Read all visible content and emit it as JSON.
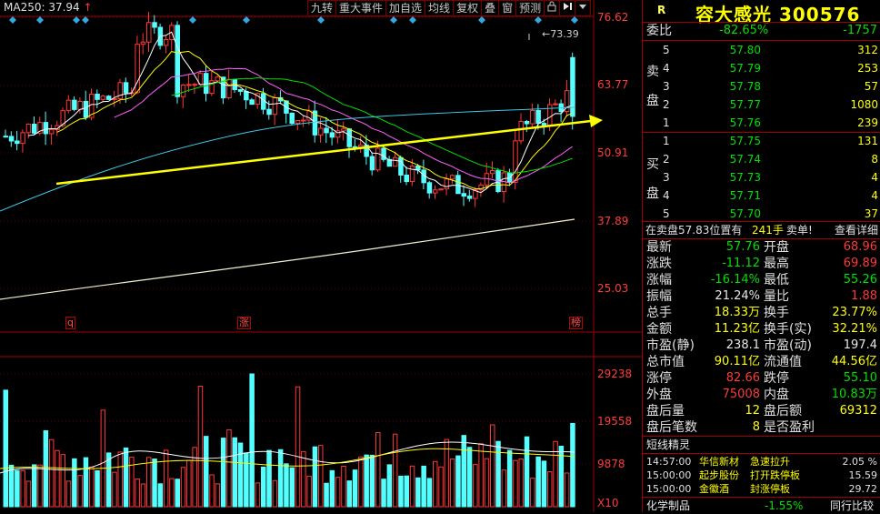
{
  "toolbar": {
    "items": [
      "九转",
      "重大事件",
      "加自选",
      "均线",
      "复权",
      "叠",
      "窗",
      "预测"
    ],
    "icons": [
      "lock-icon",
      "arrow-right-stop-icon",
      "dropdown-icon"
    ]
  },
  "ma_label": {
    "text": "MA250: 37.94",
    "arrow": "↑"
  },
  "price_axis": [
    "76.62",
    "63.77",
    "50.91",
    "37.89",
    "25.03"
  ],
  "volume_axis": [
    "29238",
    "19558",
    "9878",
    "X10"
  ],
  "annotation": "73.39",
  "markers": {
    "left": "q",
    "mid": "涨",
    "right": "榜"
  },
  "colors": {
    "up": "#ff3838",
    "down": "#54ffff",
    "border": "#a00000",
    "trend": "#ffff00"
  },
  "header": {
    "flag": "R",
    "name": "容大感光",
    "code": "300576"
  },
  "weibi": {
    "label": "委比",
    "ratio": "-82.65%",
    "diff": "-1757"
  },
  "sell_label": [
    "卖",
    "盘"
  ],
  "buy_label": [
    "买",
    "盘"
  ],
  "asks": [
    {
      "level": "5",
      "price": "57.80",
      "vol": "312"
    },
    {
      "level": "4",
      "price": "57.79",
      "vol": "253"
    },
    {
      "level": "3",
      "price": "57.78",
      "vol": "57"
    },
    {
      "level": "2",
      "price": "57.77",
      "vol": "1080"
    },
    {
      "level": "1",
      "price": "57.76",
      "vol": "239"
    }
  ],
  "bids": [
    {
      "level": "1",
      "price": "57.75",
      "vol": "131"
    },
    {
      "level": "2",
      "price": "57.74",
      "vol": "8"
    },
    {
      "level": "3",
      "price": "57.73",
      "vol": "4"
    },
    {
      "level": "4",
      "price": "57.71",
      "vol": "4"
    },
    {
      "level": "5",
      "price": "57.70",
      "vol": "37"
    }
  ],
  "big_order": {
    "text": "在卖盘57.83位置有",
    "qty": "241手",
    "type": "卖单!",
    "link": "查看详细"
  },
  "stats": [
    {
      "l1": "最新",
      "v1": "57.76",
      "c1": "green",
      "l2": "开盘",
      "v2": "68.96",
      "c2": "red"
    },
    {
      "l1": "涨跌",
      "v1": "-11.12",
      "c1": "green",
      "l2": "最高",
      "v2": "69.89",
      "c2": "red"
    },
    {
      "l1": "涨幅",
      "v1": "-16.14%",
      "c1": "green",
      "l2": "最低",
      "v2": "55.26",
      "c2": "green"
    },
    {
      "l1": "振幅",
      "v1": "21.24%",
      "c1": "white",
      "l2": "量比",
      "v2": "1.88",
      "c2": "red"
    },
    {
      "l1": "总手",
      "v1": "18.33万",
      "c1": "yellow",
      "l2": "换手",
      "v2": "23.77%",
      "c2": "yellow"
    },
    {
      "l1": "金额",
      "v1": "11.23亿",
      "c1": "yellow",
      "l2": "换手(实)",
      "v2": "32.21%",
      "c2": "yellow"
    },
    {
      "l1": "市盈(静)",
      "v1": "238.1",
      "c1": "white",
      "l2": "市盈(动)",
      "v2": "197.4",
      "c2": "white"
    },
    {
      "l1": "总市值",
      "v1": "90.11亿",
      "c1": "yellow",
      "l2": "流通值",
      "v2": "44.56亿",
      "c2": "yellow"
    },
    {
      "l1": "涨停",
      "v1": "82.66",
      "c1": "red",
      "l2": "跌停",
      "v2": "55.10",
      "c2": "green"
    },
    {
      "l1": "外盘",
      "v1": "75008",
      "c1": "red",
      "l2": "内盘",
      "v2": "10.83万",
      "c2": "green"
    },
    {
      "l1": "盘后量",
      "v1": "12",
      "c1": "yellow",
      "l2": "盘后额",
      "v2": "69312",
      "c2": "yellow"
    },
    {
      "l1": "盘后笔数",
      "v1": "8",
      "c1": "yellow",
      "l2": "是否盈利",
      "v2": "",
      "c2": "white"
    }
  ],
  "news_title": "短线精灵",
  "news": [
    {
      "time": "14:57:00",
      "stock": "华信新材",
      "event": "急速拉升",
      "value": "2.05 %"
    },
    {
      "time": "15:00:00",
      "stock": "起步股份",
      "event": "打开跌停板",
      "value": "15.59"
    },
    {
      "time": "15:00:00",
      "stock": "金徽酒",
      "event": "封涨停板",
      "value": "29.72"
    }
  ],
  "footer": {
    "left": "化学制品",
    "mid": "-1.55%",
    "right": "同行比较"
  }
}
